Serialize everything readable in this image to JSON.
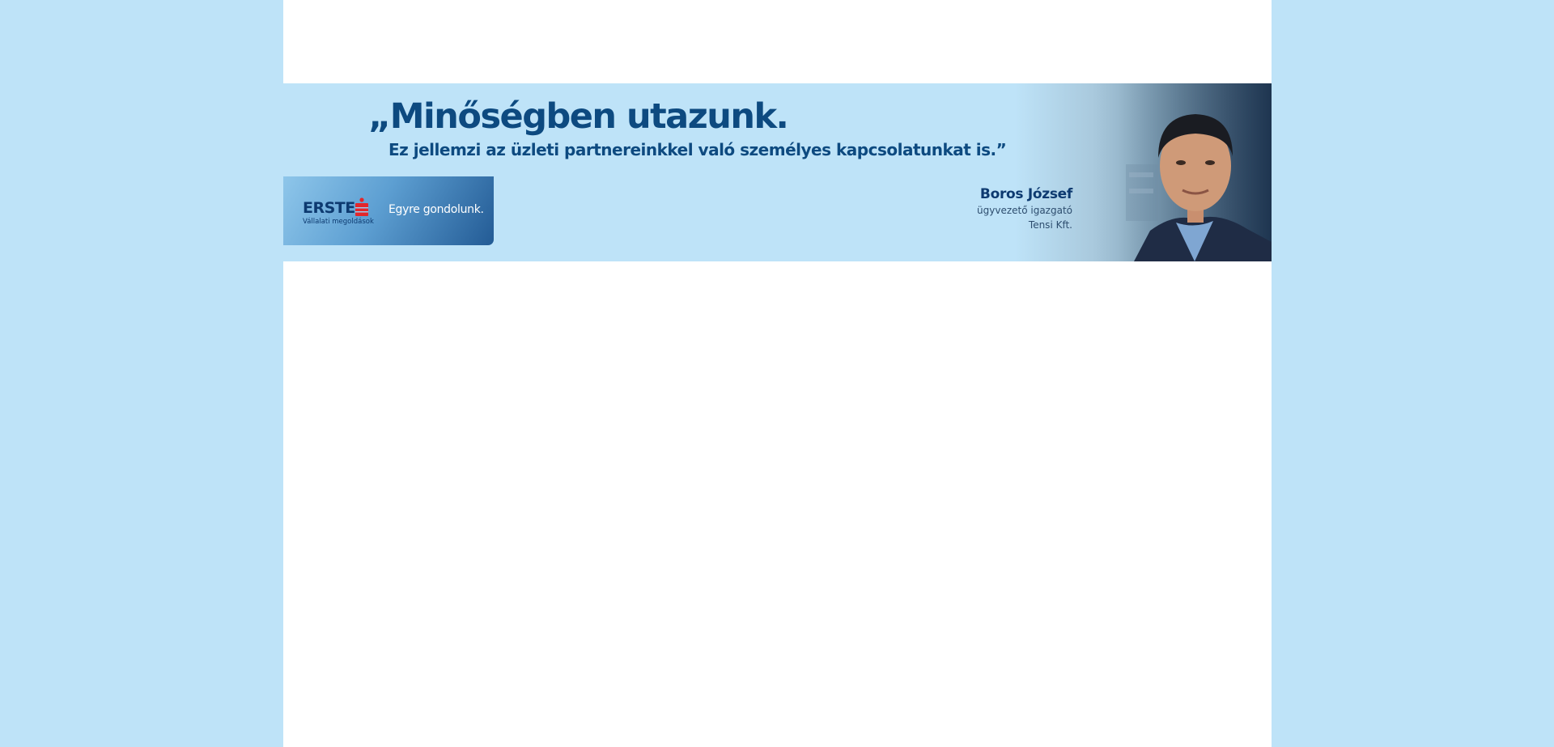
{
  "banner": {
    "headline": "„Minőségben utazunk.",
    "subline": "Ez jellemzi az üzleti partnereinkkel való személyes kapcsolatunkat is.”",
    "brand": {
      "name": "ERSTE",
      "subtitle": "Vállalati megoldások",
      "tagline": "Egyre gondolunk.",
      "mark_color": "#e3262b"
    },
    "person": {
      "name": "Boros József",
      "title": "ügyvezető igazgató",
      "company": "Tensi Kft."
    }
  },
  "colors": {
    "background": "#bee3f8",
    "page": "#ffffff",
    "headline": "#0d4a80"
  }
}
